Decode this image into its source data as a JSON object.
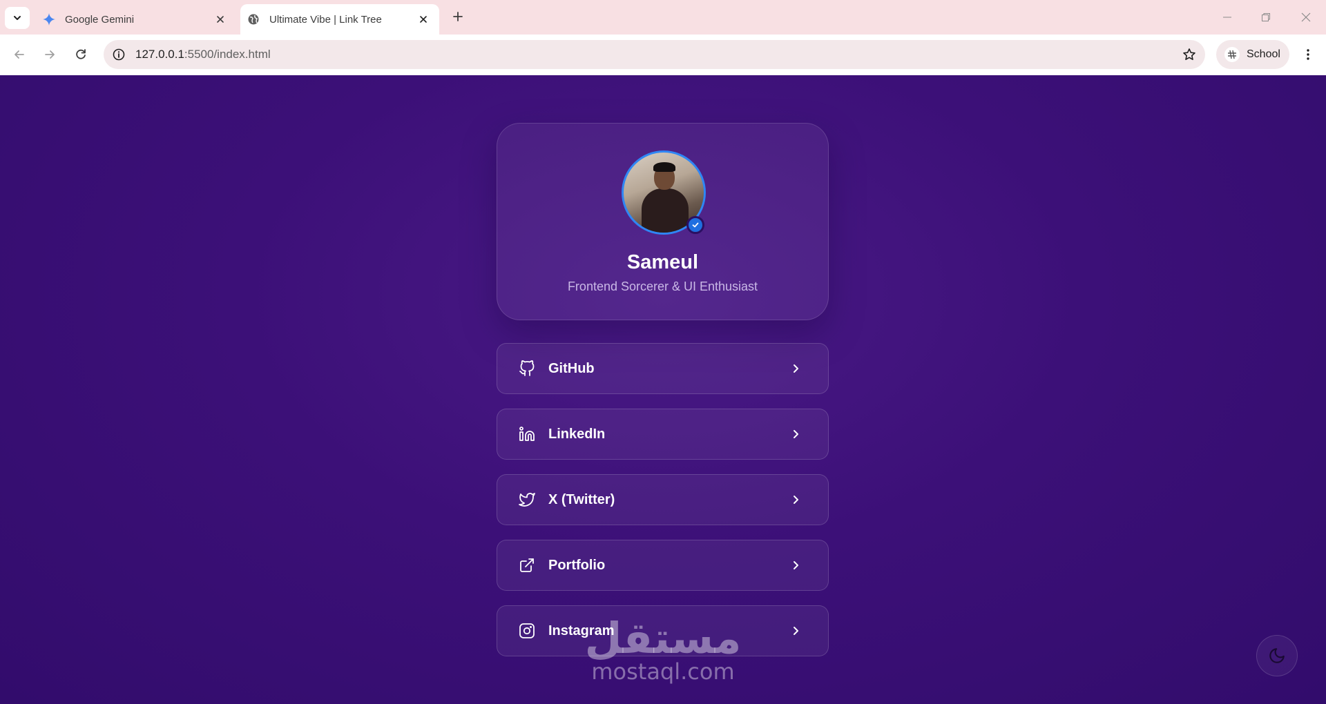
{
  "browser": {
    "tabs": [
      {
        "title": "Google Gemini",
        "active": false,
        "icon": "gemini-icon"
      },
      {
        "title": "Ultimate Vibe | Link Tree",
        "active": true,
        "icon": "globe-icon"
      }
    ],
    "address": {
      "host": "127.0.0.1",
      "path": ":5500/index.html"
    },
    "profile_label": "School"
  },
  "profile": {
    "name": "Sameul",
    "bio": "Frontend Sorcerer & UI Enthusiast"
  },
  "links": [
    {
      "label": "GitHub",
      "icon": "github-icon"
    },
    {
      "label": "LinkedIn",
      "icon": "linkedin-icon"
    },
    {
      "label": "X (Twitter)",
      "icon": "twitter-icon"
    },
    {
      "label": "Portfolio",
      "icon": "external-link-icon"
    },
    {
      "label": "Instagram",
      "icon": "instagram-icon"
    }
  ],
  "watermark": {
    "arabic": "مستقل",
    "latin": "mostaql.com"
  },
  "colors": {
    "tabstrip": "#f8e0e3",
    "page_bg": "#3c1078",
    "accent_blue": "#2f86f5",
    "text_muted": "#c9b8e6"
  }
}
